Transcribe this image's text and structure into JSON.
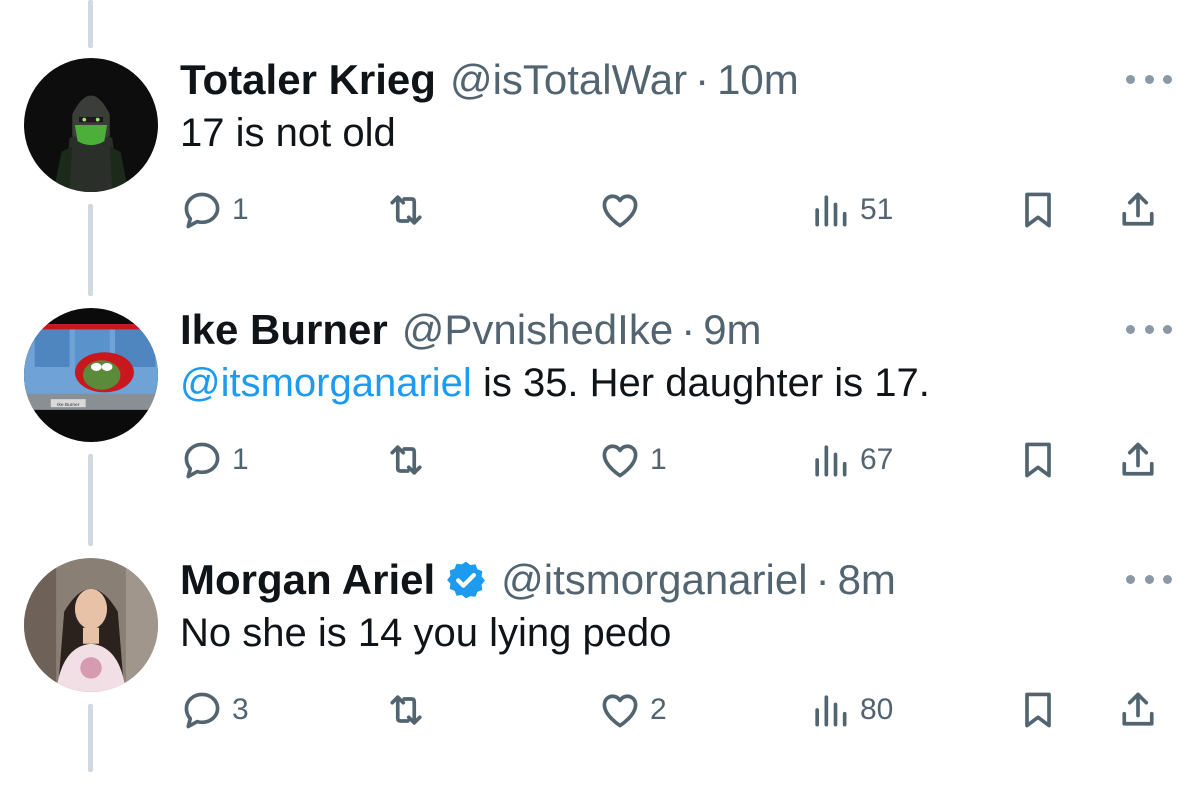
{
  "tweets": [
    {
      "name": "Totaler Krieg",
      "handle": "@isTotalWar",
      "separator": "·",
      "time": "10m",
      "verified": false,
      "mention": "",
      "text": "17 is not old",
      "actions": {
        "replies": "1",
        "retweets": "",
        "likes": "",
        "views": "51"
      },
      "avatar_icon": "ninja-avatar"
    },
    {
      "name": "Ike Burner",
      "handle": "@PvnishedIke",
      "separator": "·",
      "time": "9m",
      "verified": false,
      "mention": "@itsmorganariel",
      "text": " is 35. Her daughter is 17.",
      "avatar_label": "Ike Burner",
      "actions": {
        "replies": "1",
        "retweets": "",
        "likes": "1",
        "views": "67"
      },
      "avatar_icon": "frog-desk-avatar"
    },
    {
      "name": "Morgan Ariel",
      "handle": "@itsmorganariel",
      "separator": "·",
      "time": "8m",
      "verified": true,
      "mention": "",
      "text": "No she is 14 you lying pedo",
      "actions": {
        "replies": "3",
        "retweets": "",
        "likes": "2",
        "views": "80"
      },
      "avatar_icon": "woman-avatar"
    }
  ],
  "colors": {
    "text": "#0f1419",
    "secondary": "#536471",
    "link": "#1d9bf0",
    "thread_line": "#cfd9de"
  }
}
